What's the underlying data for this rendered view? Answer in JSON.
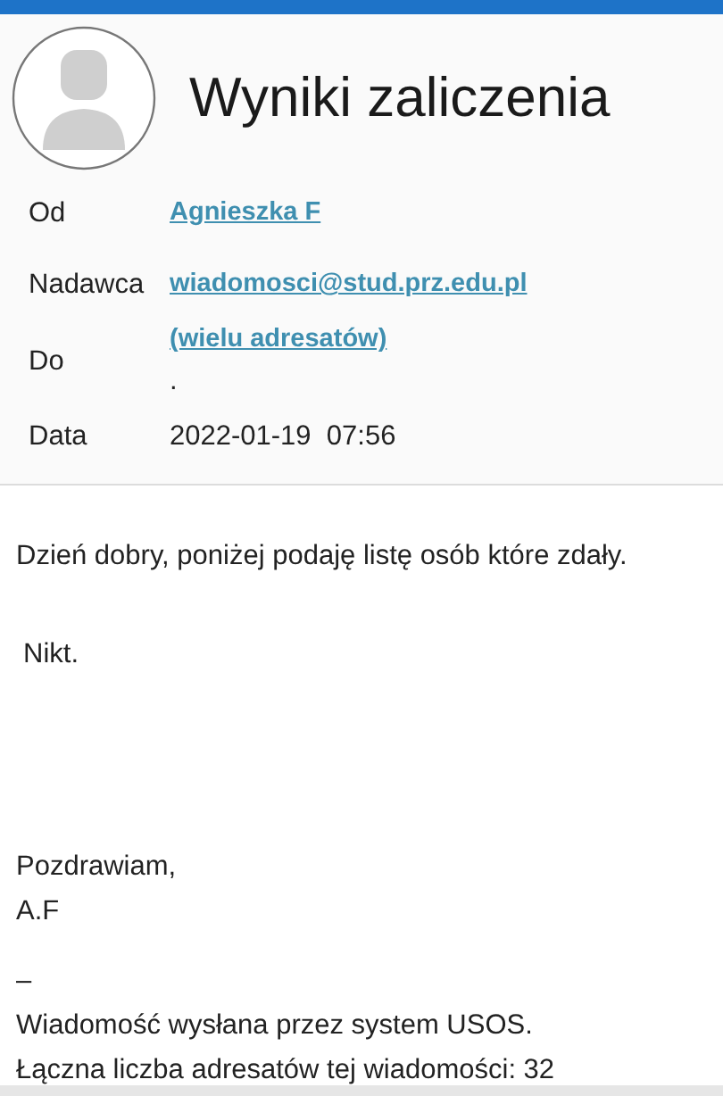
{
  "message": {
    "subject": "Wyniki zaliczenia",
    "headers": [
      {
        "label": "Od",
        "lines": [
          {
            "text": "Agnieszka F",
            "link": true
          }
        ]
      },
      {
        "label": "Nadawca",
        "lines": [
          {
            "text": "wiadomosci@stud.prz.edu.pl",
            "link": true
          }
        ]
      },
      {
        "label": "Do",
        "lines": [
          {
            "text": "(wielu adresatów)",
            "link": true
          },
          {
            "text": ".",
            "link": false
          }
        ]
      },
      {
        "label": "Data",
        "lines": [
          {
            "text": "2022-01-19  07:56",
            "link": false
          }
        ]
      }
    ],
    "body": [
      {
        "kind": "para",
        "text": "Dzień dobry, poniżej podaję listę osób które zdały."
      },
      {
        "kind": "indented",
        "text": "Nikt."
      },
      {
        "kind": "gap"
      },
      {
        "kind": "line",
        "text": "Pozdrawiam,"
      },
      {
        "kind": "line",
        "text": "A.F"
      },
      {
        "kind": "spacer"
      },
      {
        "kind": "line",
        "text": "–"
      },
      {
        "kind": "line",
        "text": "Wiadomość wysłana przez system USOS."
      },
      {
        "kind": "line",
        "text": "Łączna liczba adresatów tej wiadomości: 32"
      }
    ]
  }
}
